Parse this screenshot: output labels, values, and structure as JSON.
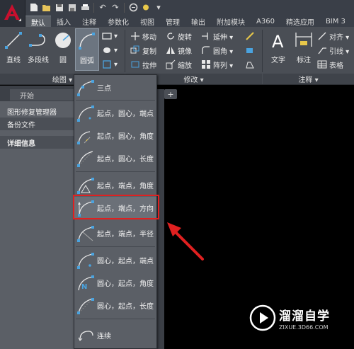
{
  "quick_access": {
    "icons": [
      "new-icon",
      "open-icon",
      "save-icon",
      "saveas-icon",
      "print-icon",
      "undo-icon",
      "redo-icon",
      "share-icon",
      "workspace-icon"
    ]
  },
  "tabs": [
    {
      "label": "默认",
      "active": true
    },
    {
      "label": "插入",
      "active": false
    },
    {
      "label": "注释",
      "active": false
    },
    {
      "label": "参数化",
      "active": false
    },
    {
      "label": "视图",
      "active": false
    },
    {
      "label": "管理",
      "active": false
    },
    {
      "label": "输出",
      "active": false
    },
    {
      "label": "附加模块",
      "active": false
    },
    {
      "label": "A360",
      "active": false
    },
    {
      "label": "精选应用",
      "active": false
    },
    {
      "label": "BIM 3",
      "active": false
    }
  ],
  "ribbon": {
    "draw": {
      "panel_label": "绘图 ▾",
      "line": "直线",
      "polyline": "多段线",
      "circle": "圆",
      "arc": "圆弧"
    },
    "modify": {
      "panel_label": "修改 ▾",
      "move": "移动",
      "rotate": "旋转",
      "trim": "延伸 ▾",
      "copy": "复制",
      "mirror": "镜像",
      "fillet": "圆角 ▾",
      "stretch": "拉伸",
      "scale": "缩放",
      "array": "阵列 ▾"
    },
    "annotation": {
      "panel_label": "注释 ▾",
      "text": "文字",
      "dimension": "标注",
      "align": "对齐 ▾",
      "leader": "引线 ▾",
      "table": "表格"
    }
  },
  "left_panel": {
    "start_tab": "开始",
    "items": [
      "图形修复管理器",
      "备份文件",
      "详细信息"
    ]
  },
  "arc_menu": {
    "items": [
      {
        "label": "三点"
      },
      {
        "label": "起点，圆心，端点"
      },
      {
        "label": "起点，圆心，角度"
      },
      {
        "label": "起点，圆心，长度"
      },
      {
        "label": "起点，端点，角度"
      },
      {
        "label": "起点，端点，方向"
      },
      {
        "label": "起点，端点，半径"
      },
      {
        "label": "圆心，起点，端点"
      },
      {
        "label": "圆心，起点，角度"
      },
      {
        "label": "圆心，起点，长度"
      },
      {
        "label": "连续"
      }
    ],
    "highlighted_index": 5
  },
  "watermark": {
    "title": "溜溜自学",
    "url": "ZIXUE.3D66.COM"
  },
  "colors": {
    "accent_red": "#e02020",
    "ribbon_bg": "#4a4e55",
    "canvas_bg": "#000000",
    "logo_red": "#c8102e"
  }
}
